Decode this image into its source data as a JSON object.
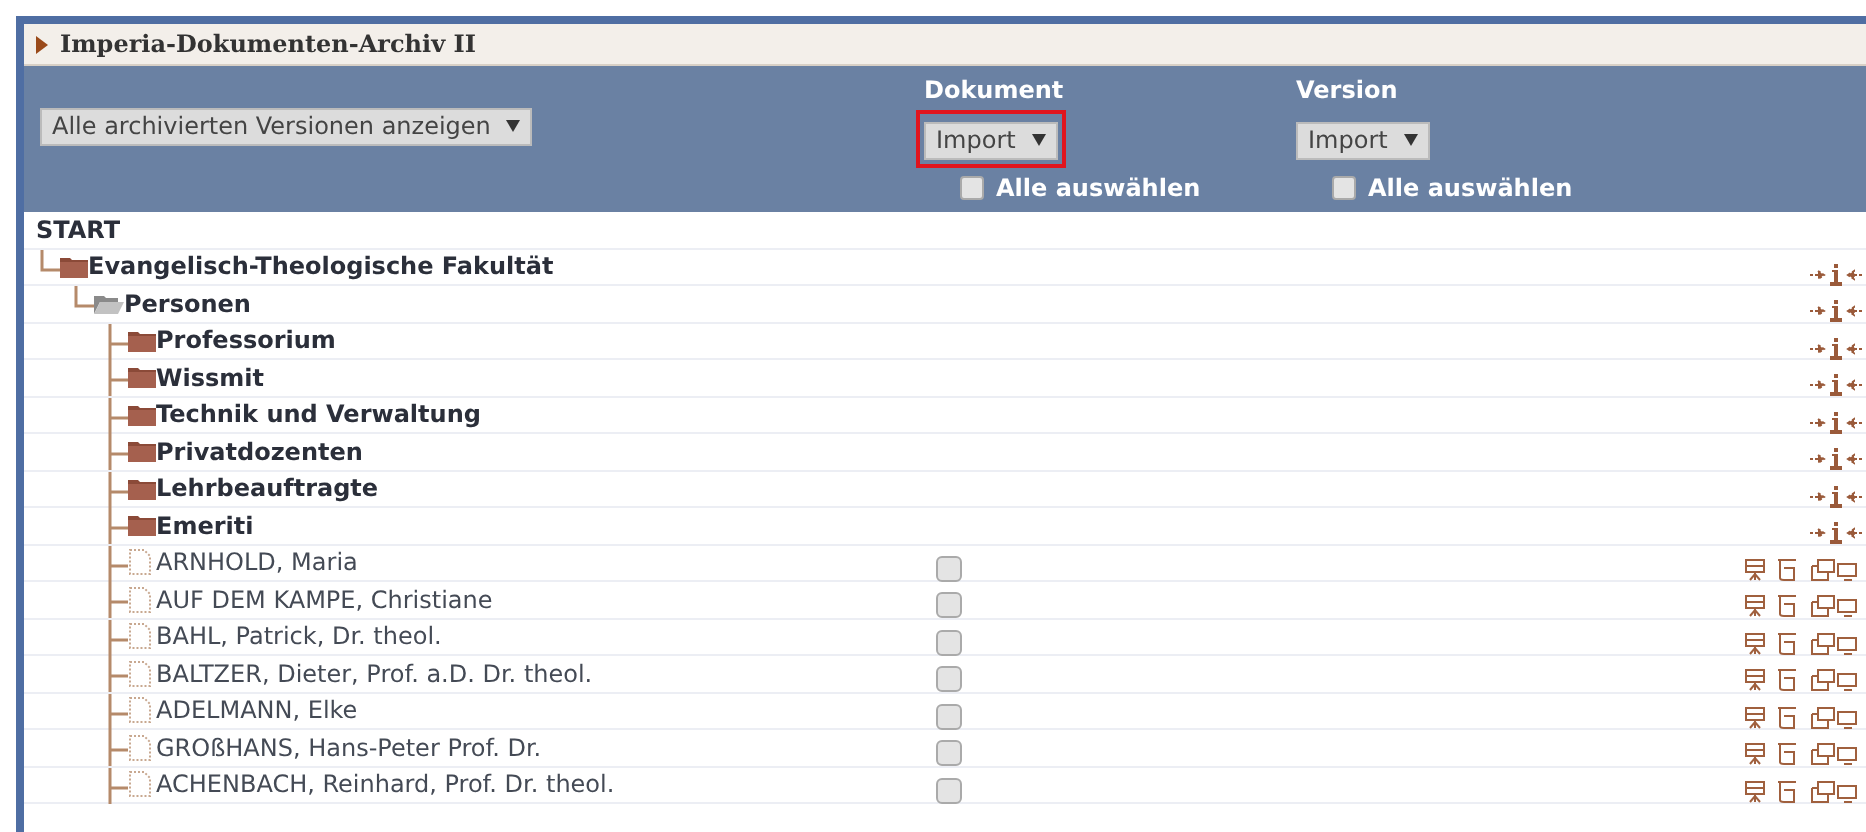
{
  "title": "Imperia-Dokumenten-Archiv II",
  "filter": {
    "value": "Alle archivierten Versionen anzeigen"
  },
  "columns": [
    {
      "heading": "Dokument",
      "select": "Import",
      "highlighted": true,
      "select_all": {
        "label": "Alle auswählen",
        "checked": false
      }
    },
    {
      "heading": "Version",
      "select": "Import",
      "highlighted": false,
      "select_all": {
        "label": "Alle auswählen",
        "checked": false
      }
    }
  ],
  "tree": {
    "label": "START",
    "children": [
      {
        "kind": "folder",
        "label": "Evangelisch-Theologische Fakultät",
        "expanded": false,
        "children": [
          {
            "kind": "folder",
            "label": "Personen",
            "expanded": true,
            "children": [
              {
                "kind": "folder",
                "label": "Professorium",
                "expanded": false
              },
              {
                "kind": "folder",
                "label": "Wissmit",
                "expanded": false
              },
              {
                "kind": "folder",
                "label": "Technik und Verwaltung",
                "expanded": false
              },
              {
                "kind": "folder",
                "label": "Privatdozenten",
                "expanded": false
              },
              {
                "kind": "folder",
                "label": "Lehrbeauftragte",
                "expanded": false
              },
              {
                "kind": "folder",
                "label": "Emeriti",
                "expanded": false
              },
              {
                "kind": "document",
                "label": "ARNHOLD, Maria",
                "checked": false
              },
              {
                "kind": "document",
                "label": "AUF DEM KAMPE, Christiane",
                "checked": false
              },
              {
                "kind": "document",
                "label": "BAHL, Patrick, Dr. theol.",
                "checked": false
              },
              {
                "kind": "document",
                "label": "BALTZER, Dieter, Prof. a.D. Dr. theol.",
                "checked": false
              },
              {
                "kind": "document",
                "label": "ADELMANN, Elke",
                "checked": false
              },
              {
                "kind": "document",
                "label": "GROßHANS, Hans-Peter Prof. Dr.",
                "checked": false
              },
              {
                "kind": "document",
                "label": "ACHENBACH, Reinhard, Prof. Dr. theol.",
                "checked": false
              }
            ]
          }
        ]
      }
    ]
  }
}
